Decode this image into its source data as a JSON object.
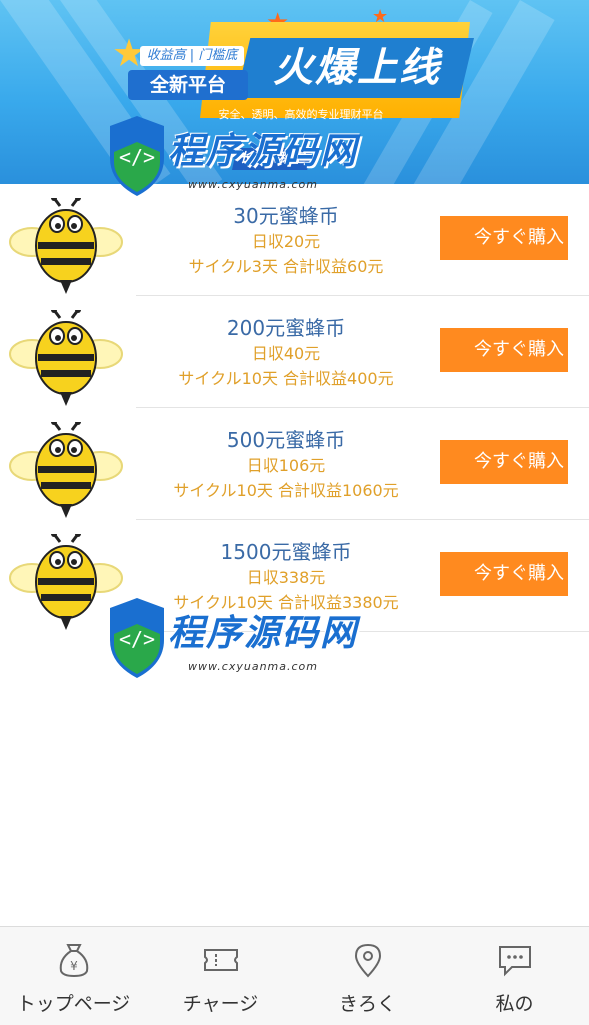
{
  "banner": {
    "tag_top": "收益高 | 门槛底",
    "tag_bottom": "全新平台",
    "title": "火爆上线",
    "subtitle": "安全、透明、高效的专业理财平台",
    "badge": "长久，稳定"
  },
  "watermark": {
    "text": "程序源码网",
    "url": "www.cxyuanma.com"
  },
  "products": [
    {
      "name": "30元蜜蜂币",
      "daily": "日収20元",
      "cycle": "サイクル3天 合計収益60元",
      "button": "今すぐ購入"
    },
    {
      "name": "200元蜜蜂币",
      "daily": "日収40元",
      "cycle": "サイクル10天 合計収益400元",
      "button": "今すぐ購入"
    },
    {
      "name": "500元蜜蜂币",
      "daily": "日収106元",
      "cycle": "サイクル10天 合計収益1060元",
      "button": "今すぐ購入"
    },
    {
      "name": "1500元蜜蜂币",
      "daily": "日収338元",
      "cycle": "サイクル10天 合計収益3380元",
      "button": "今すぐ購入"
    }
  ],
  "nav": {
    "items": [
      {
        "label": "トップページ",
        "icon": "money-bag-icon"
      },
      {
        "label": "チャージ",
        "icon": "ticket-icon"
      },
      {
        "label": "きろく",
        "icon": "location-pin-icon"
      },
      {
        "label": "私の",
        "icon": "chat-bubble-icon"
      }
    ]
  },
  "colors": {
    "banner_blue": "#39a9ec",
    "accent_orange": "#ff8a1f",
    "price_blue": "#3a6aa6",
    "detail_gold": "#e0a02a"
  }
}
